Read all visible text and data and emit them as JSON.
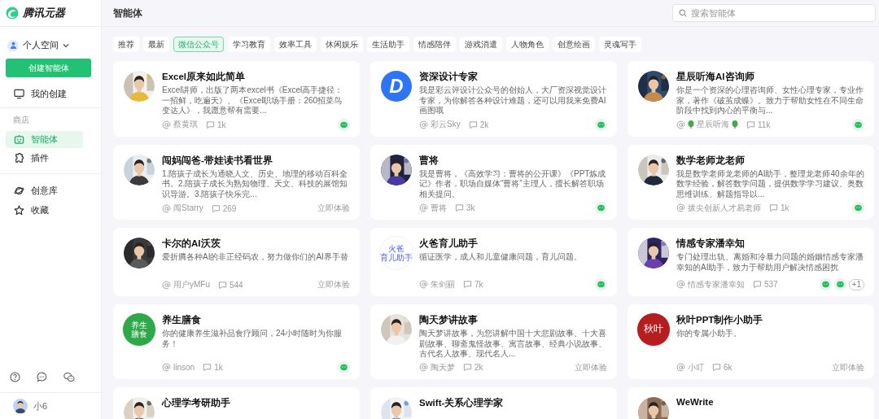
{
  "sidebar": {
    "logo_text": "腾讯元器",
    "space": "个人空间",
    "create_button": "创建智能体",
    "nav": [
      {
        "label": "我的创建",
        "selected": false
      }
    ],
    "section_label": "商店",
    "store": [
      {
        "label": "智能体",
        "selected": true
      },
      {
        "label": "插件",
        "selected": false
      }
    ],
    "library": [
      {
        "label": "创意库",
        "selected": false
      },
      {
        "label": "收藏",
        "selected": false
      }
    ],
    "user": "小6"
  },
  "header": {
    "title": "智能体",
    "search": {
      "placeholder": "搜索智能体"
    }
  },
  "tabs": [
    {
      "label": "推荐",
      "selected": false
    },
    {
      "label": "最新",
      "selected": false
    },
    {
      "label": "微信公众号",
      "selected": true
    },
    {
      "label": "学习教育",
      "selected": false
    },
    {
      "label": "效率工具",
      "selected": false
    },
    {
      "label": "休闲娱乐",
      "selected": false
    },
    {
      "label": "生活助手",
      "selected": false
    },
    {
      "label": "情感陪伴",
      "selected": false
    },
    {
      "label": "游戏消遣",
      "selected": false
    },
    {
      "label": "人物角色",
      "selected": false
    },
    {
      "label": "创意绘画",
      "selected": false
    },
    {
      "label": "灵魂写手",
      "selected": false
    }
  ],
  "cards": [
    {
      "avatar": {
        "kind": "picture"
      },
      "title": "Excel原来如此简单",
      "description": "Excel讲师，出版了两本excel书《Excel高手捷径：一招鲜，吃遍天》、《Excel职场手册：260招菜鸟变达人》，我愿意帮有需要...",
      "author": "蔡黄琪",
      "comments": "1k",
      "badges": [
        {
          "kind": "wechat"
        }
      ]
    },
    {
      "avatar": {
        "kind": "letter",
        "text": "D"
      },
      "title": "资深设计专家",
      "description": "我是彩云评设计公众号的创始人，大厂资深视觉设计专家，为你解答各种设计难题，还可以用我来免费AI画图哦",
      "author": "彩云Sky",
      "comments": "2k",
      "badges": [
        {
          "kind": "wechat"
        }
      ]
    },
    {
      "avatar": {
        "kind": "picture"
      },
      "title": "星辰听海AI咨询师",
      "description": "你是一个资深的心理咨询师、女性心理专家，专业作家，著作《破茧成蝶》。致力于帮助女性在不同生命阶段中找到内心的平衡与...",
      "author": "星辰听海",
      "author_leaves": true,
      "comments": "11k",
      "badges": [
        {
          "kind": "wechat"
        }
      ]
    },
    {
      "avatar": {
        "kind": "picture"
      },
      "title": "闯妈闯爸-带娃读书看世界",
      "description": "1.陪孩子成长为通晓人文、历史、地理的移动百科全书。2.陪孩子成长为熟知物理、天文、科技的展馆知识导游。3.陪孩子快乐完...",
      "author": "闯Starry",
      "comments": "269",
      "action": "立即体验"
    },
    {
      "avatar": {
        "kind": "picture"
      },
      "title": "曹将",
      "description": "我是曹将，《高效学习：曹将的公开课》《PPT炼成记》作者，职场自媒体“曹将”主理人，擅长解答职场相关提问。",
      "author": "曹将",
      "comments": "3k",
      "badges": [
        {
          "kind": "wechat"
        }
      ]
    },
    {
      "avatar": {
        "kind": "picture"
      },
      "title": "数学老师龙老师",
      "description": "我是数学老师龙老师的AI助手，整理龙老师40余年的数学经验，解答数学问题，提供数学学习建议、奥数思维训练、解题指导以...",
      "author": "拔尖创新人才易老师",
      "comments": "1k",
      "badges": [
        {
          "kind": "wechat"
        }
      ]
    },
    {
      "avatar": {
        "kind": "picture"
      },
      "title": "卡尔的AI沃茨",
      "description": "爱折腾各种AI的非正经码农，努力做你们的AI界手替",
      "author": "用户yMFu",
      "comments": "544",
      "action": "立即体验"
    },
    {
      "avatar": {
        "kind": "text",
        "lines": [
          "火爸",
          "育儿助手"
        ]
      },
      "title": "火爸育儿助手",
      "description": "循证医学，成人和儿童健康问题，育儿问题。",
      "author": "朱剑丽",
      "comments": "7k",
      "badges": [
        {
          "kind": "wechat"
        }
      ]
    },
    {
      "avatar": {
        "kind": "picture"
      },
      "title": "情感专家潘幸知",
      "description": "专门处理出轨、离婚和冷暴力问题的婚姻情感专家潘幸知的AI助手，致力于帮助用户解决情感困扰",
      "author": "情感专家潘幸知",
      "comments": "537",
      "badges": [
        {
          "kind": "wechat"
        },
        {
          "kind": "wechat"
        }
      ],
      "more": "+1"
    },
    {
      "avatar": {
        "kind": "text",
        "lines": [
          "养生",
          "膳食"
        ]
      },
      "title": "养生膳食",
      "description": "你的健康养生滋补品食疗顾问，24小时随时为你服务！",
      "author": "linson",
      "comments": "1k",
      "badges": [
        {
          "kind": "wechat"
        }
      ]
    },
    {
      "avatar": {
        "kind": "picture"
      },
      "title": "陶天梦讲故事",
      "description": "陶天梦讲故事，为您讲解中国十大悲剧故事、十大喜剧故事、聊斋鬼怪故事、寓言故事、经典小说故事、古代名人故事、现代名人...",
      "author": "陶天梦",
      "comments": "2k",
      "action": "立即体验"
    },
    {
      "avatar": {
        "kind": "text",
        "lines": [
          "秋叶"
        ]
      },
      "title": "秋叶PPT制作小助手",
      "description": "你的专属小助手。",
      "author": "小叮",
      "comments": "6k",
      "action": "立即体验"
    },
    {
      "avatar": {
        "kind": "picture"
      },
      "title": "心理学考研助手"
    },
    {
      "avatar": {
        "kind": "picture"
      },
      "title": "Swift-关系心理学家"
    },
    {
      "avatar": {
        "kind": "picture"
      },
      "title": "WeWrite"
    }
  ]
}
